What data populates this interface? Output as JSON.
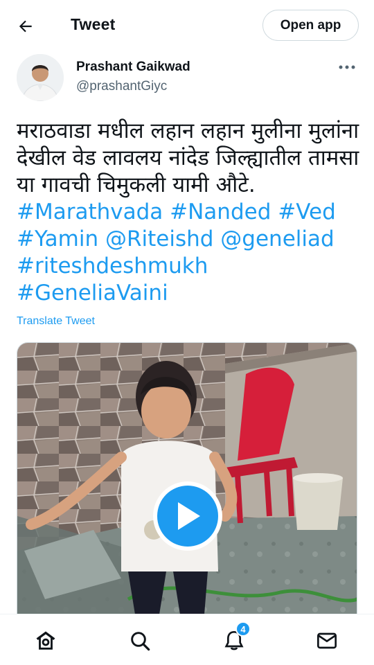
{
  "header": {
    "title": "Tweet",
    "open_app_label": "Open app"
  },
  "author": {
    "name": "Prashant Gaikwad",
    "handle": "@prashantGiyc"
  },
  "tweet": {
    "text_plain": "मराठवाडा मधील लहान लहान मुलीना मुलांना देखील वेड लावलय नांदेड जिल्ह्यातील तामसा या गावची चिमुकली यामी औटे.",
    "tags": [
      "#Marathvada",
      "#Nanded",
      "#Ved",
      "#Yamin",
      "@Riteishd",
      "@geneliad",
      "#riteshdeshmukh",
      "#GeneliaVaini"
    ],
    "translate_label": "Translate Tweet"
  },
  "media": {
    "type": "video",
    "play_icon": "play-icon"
  },
  "nav": {
    "items": [
      {
        "name": "home",
        "icon": "home-icon"
      },
      {
        "name": "search",
        "icon": "search-icon"
      },
      {
        "name": "notifications",
        "icon": "bell-icon",
        "badge": "4"
      },
      {
        "name": "messages",
        "icon": "mail-icon"
      }
    ]
  },
  "colors": {
    "accent": "#1d9bf0",
    "text": "#0f1419",
    "secondary": "#536471",
    "border": "#cfd9de"
  }
}
